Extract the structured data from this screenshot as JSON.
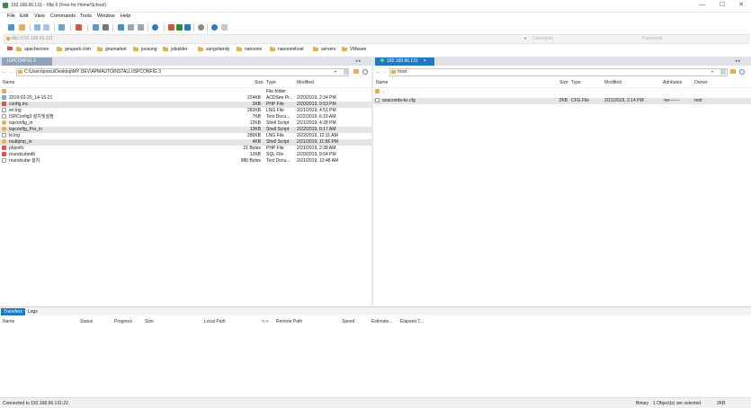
{
  "window": {
    "title": "192.168.66.131 - Xftp 6 (Free for Home/School)",
    "controls": {
      "minimize": "—",
      "maximize": "☐",
      "close": "✕"
    }
  },
  "menu": [
    "File",
    "Edit",
    "View",
    "Commands",
    "Tools",
    "Window",
    "Help"
  ],
  "address": {
    "value": "sftp://192.168.66.131",
    "username_placeholder": "Username",
    "password_placeholder": "Password"
  },
  "bookmarks": [
    "apachezone",
    "gnupark.com",
    "gnumarket",
    "joosung",
    "jsbuilder",
    "sungsfamily",
    "nanoomi",
    "nanoomihost",
    "servers",
    "VMware"
  ],
  "left_pane": {
    "tab": "ISPCONFIG 3",
    "path": "C:\\Users\\joosu\\Desktop\\MY DEV\\APMAUTOINSTALL\\ISPCONFIG 3",
    "columns": {
      "name": "Name",
      "size": "Size",
      "type": "Type",
      "modified": "Modified"
    },
    "rows": [
      {
        "name": "..",
        "size": "",
        "type": "File folder",
        "modified": ""
      },
      {
        "name": "2019-02-20_14-15-21",
        "size": "224KB",
        "type": "ACDSee Pr...",
        "modified": "2/20/2019, 2:34 PM"
      },
      {
        "name": "config.inc",
        "size": "3KB",
        "type": "PHP File",
        "modified": "2/20/2019, 9:53 PM"
      },
      {
        "name": "en.lng",
        "size": "283KB",
        "type": "LNG File",
        "modified": "2/21/2019, 4:51 PM"
      },
      {
        "name": "ISPConfig3 설치및설정",
        "size": "7KB",
        "type": "Text Docu...",
        "modified": "2/22/2019, 6:19 AM"
      },
      {
        "name": "ispconfig_in",
        "size": "12KB",
        "type": "Shell Script",
        "modified": "2/21/2019, 4:28 PM"
      },
      {
        "name": "ispconfig_Pro_in",
        "size": "13KB",
        "type": "Shell Script",
        "modified": "2/22/2019, 6:17 AM"
      },
      {
        "name": "kr.lng",
        "size": "286KB",
        "type": "LNG File",
        "modified": "2/22/2019, 12:11 AM"
      },
      {
        "name": "multiphp_in",
        "size": "4KB",
        "type": "Shell Script",
        "modified": "2/21/2019, 11:56 PM"
      },
      {
        "name": "phpinfo",
        "size": "21 Bytes",
        "type": "PHP File",
        "modified": "2/21/2019, 2:38 AM"
      },
      {
        "name": "roundcubedb",
        "size": "12KB",
        "type": "SQL File",
        "modified": "2/20/2019, 9:54 PM"
      },
      {
        "name": "roundcube 설치",
        "size": "980 Bytes",
        "type": "Text Docu...",
        "modified": "2/21/2019, 12:48 AM"
      }
    ]
  },
  "right_pane": {
    "tab": "192.168.66.131",
    "path": "/root",
    "columns": {
      "name": "Name",
      "size": "Size",
      "type": "Type",
      "modified": "Modified",
      "attributes": "Attributes",
      "owner": "Owner"
    },
    "rows": [
      {
        "name": "..",
        "size": "",
        "type": "",
        "modified": "",
        "attributes": "",
        "owner": ""
      },
      {
        "name": "anaconda-ks.cfg",
        "size": "2KB",
        "type": "CFG File",
        "modified": "2/21/2019, 2:14 PM",
        "attributes": "-rw-------",
        "owner": "root"
      }
    ]
  },
  "transfers": {
    "tabs": [
      "Transfers",
      "Logs"
    ],
    "columns": [
      "Name",
      "Status",
      "Progress",
      "Size",
      "Local Path",
      "<->",
      "Remote Path",
      "Speed",
      "Estimate...",
      "Elapsed T..."
    ]
  },
  "status": {
    "left": "Connected to 192.168.66.131:22.",
    "mode": "Binary",
    "selection": "1 Object(s) are selected",
    "size": "2KB"
  },
  "colors": {
    "accent": "#1f7ac2",
    "folder": "#e8b04a",
    "selected_row": "#e4e4e4"
  }
}
